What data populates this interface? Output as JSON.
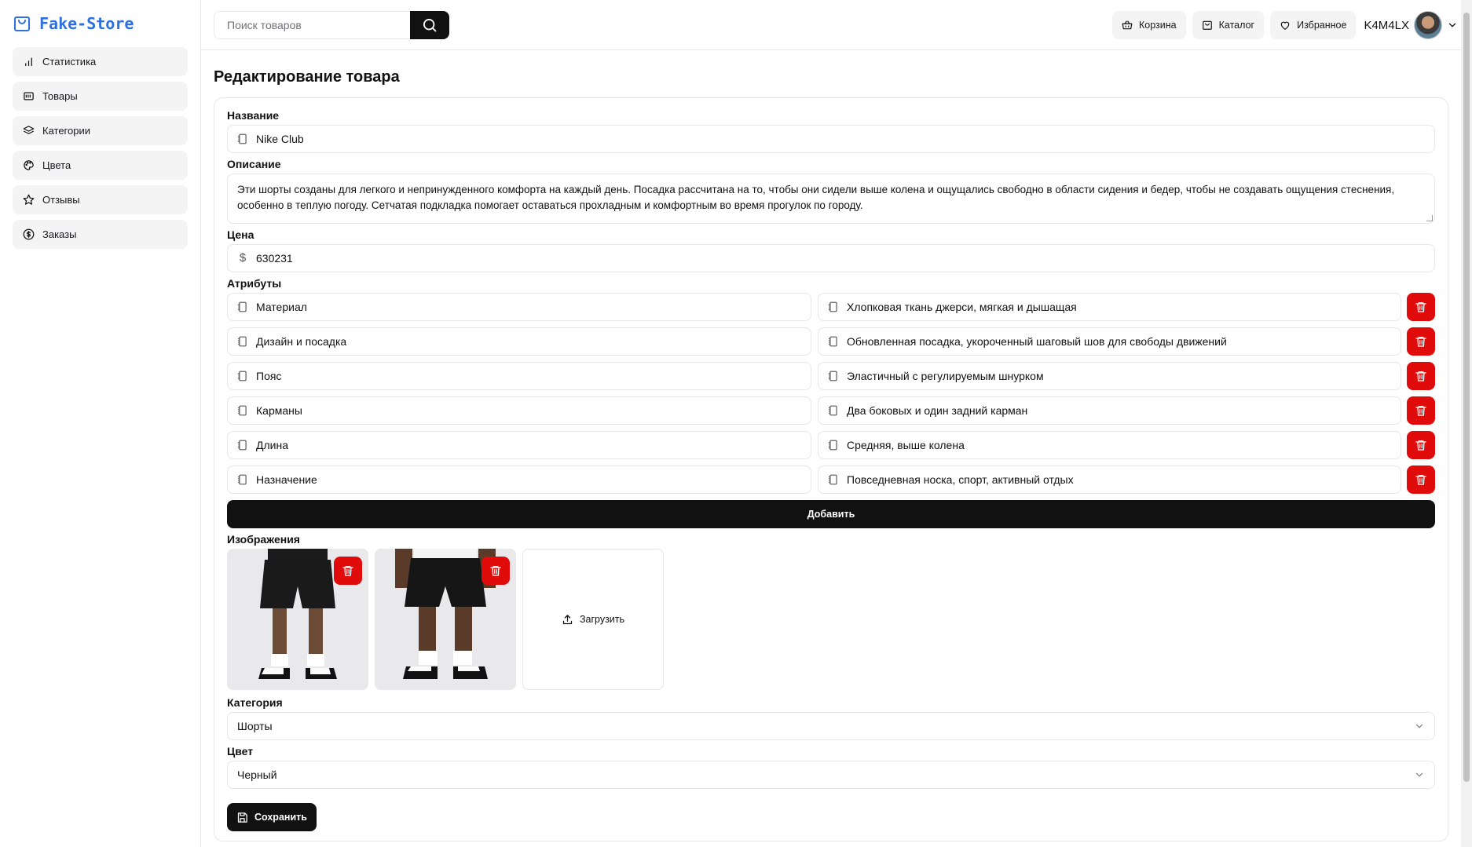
{
  "brand": {
    "name": "Fake-Store",
    "color": "#2f6fde"
  },
  "sidebar": {
    "items": [
      {
        "label": "Статистика",
        "icon": "bar-chart-icon"
      },
      {
        "label": "Товары",
        "icon": "products-icon"
      },
      {
        "label": "Категории",
        "icon": "layers-icon"
      },
      {
        "label": "Цвета",
        "icon": "palette-icon"
      },
      {
        "label": "Отзывы",
        "icon": "star-icon"
      },
      {
        "label": "Заказы",
        "icon": "dollar-icon"
      }
    ]
  },
  "header": {
    "search_placeholder": "Поиск товаров",
    "cart_label": "Корзина",
    "catalog_label": "Каталог",
    "favorites_label": "Избранное",
    "username": "K4M4LX"
  },
  "page": {
    "title": "Редактирование товара",
    "name_label": "Название",
    "name_value": "Nike Club",
    "description_label": "Описание",
    "description_value": "Эти шорты созданы для легкого и непринужденного комфорта на каждый день. Посадка рассчитана на то, чтобы они сидели выше колена и ощущались свободно в области сидения и бедер, чтобы не создавать ощущения стеснения, особенно в теплую погоду. Сетчатая подкладка помогает оставаться прохладным и комфортным во время прогулок по городу.",
    "price_label": "Цена",
    "price_value": "630231",
    "attributes_label": "Атрибуты",
    "attributes": [
      {
        "key": "Материал",
        "value": "Хлопковая ткань джерси, мягкая и дышащая"
      },
      {
        "key": "Дизайн и посадка",
        "value": "Обновленная посадка, укороченный шаговый шов для свободы движений"
      },
      {
        "key": "Пояс",
        "value": "Эластичный с регулируемым шнурком"
      },
      {
        "key": "Карманы",
        "value": "Два боковых и один задний карман"
      },
      {
        "key": "Длина",
        "value": "Средняя, выше колена"
      },
      {
        "key": "Назначение",
        "value": "Повседневная носка, спорт, активный отдых"
      }
    ],
    "add_label": "Добавить",
    "images_label": "Изображения",
    "upload_label": "Загрузить",
    "category_label": "Категория",
    "category_value": "Шорты",
    "color_label": "Цвет",
    "color_value": "Черный",
    "save_label": "Сохранить"
  },
  "colors": {
    "danger": "#e00b0b",
    "primary": "#111111"
  }
}
